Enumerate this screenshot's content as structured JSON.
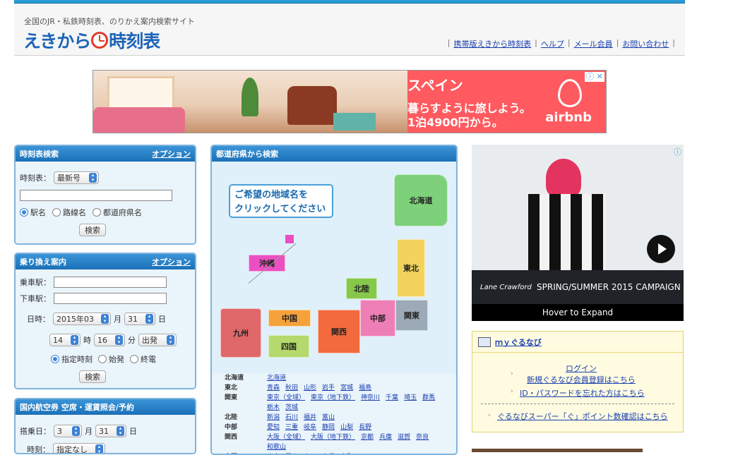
{
  "header": {
    "tagline": "全国のJR・私鉄時刻表、のりかえ案内検索サイト",
    "logo_left": "えきから",
    "logo_right": "時刻表",
    "links": [
      "携帯版えきから時刻表",
      "ヘルプ",
      "メール会員",
      "お問い合わせ"
    ]
  },
  "ad_banner": {
    "title": "スペイン",
    "line1": "暮らすように旅しよう。",
    "line2": "1泊4900円から。",
    "brand": "airbnb",
    "close": "ⓘ ✕"
  },
  "timetable": {
    "title": "時刻表検索",
    "option": "オプション",
    "label": "時刻表：",
    "select": "最新号",
    "radios": [
      "駅名",
      "路線名",
      "都道府県名"
    ],
    "search": "検索"
  },
  "transfer": {
    "title": "乗り換え案内",
    "option": "オプション",
    "from_label": "乗車駅：",
    "to_label": "下車駅：",
    "date_label": "日時：",
    "year": "2015年03",
    "month_unit": "月",
    "day": "31",
    "day_unit": "日",
    "hour": "14",
    "hour_unit": "時",
    "minute": "16",
    "minute_unit": "分",
    "mode": "出発",
    "radios": [
      "指定時刻",
      "始発",
      "終電"
    ],
    "search": "検索"
  },
  "flight": {
    "title": "国内航空券 空席・運賃照会/予約",
    "date_label": "搭乗日：",
    "month": "3",
    "month_unit": "月",
    "day": "31",
    "day_unit": "日",
    "time_label": "時刻：",
    "time": "指定なし"
  },
  "map_panel": {
    "title": "都道府県から検索",
    "hint_line1": "ご希望の地域名を",
    "hint_line2": "クリックしてください",
    "regions": {
      "hokkaido": "北海道",
      "tohoku": "東北",
      "hokuriku": "北陸",
      "kanto": "関東",
      "chubu": "中部",
      "kansai": "関西",
      "chugoku": "中国",
      "shikoku": "四国",
      "kyushu": "九州",
      "okinawa": "沖縄"
    },
    "region_list": [
      {
        "name": "北海道",
        "prefs": [
          "北海道"
        ]
      },
      {
        "name": "東北",
        "prefs": [
          "青森",
          "秋田",
          "山形",
          "岩手",
          "宮城",
          "福島"
        ]
      },
      {
        "name": "関東",
        "prefs": [
          "東京（全域）",
          "東京（地下鉄）",
          "神奈川",
          "千葉",
          "埼玉",
          "群馬",
          "栃木",
          "茨城"
        ]
      },
      {
        "name": "北陸",
        "prefs": [
          "新潟",
          "石川",
          "福井",
          "富山"
        ]
      },
      {
        "name": "中部",
        "prefs": [
          "愛知",
          "三重",
          "岐阜",
          "静岡",
          "山梨",
          "長野"
        ]
      },
      {
        "name": "関西",
        "prefs": [
          "大阪（全域）",
          "大阪（地下鉄）",
          "京都",
          "兵庫",
          "滋賀",
          "奈良",
          "和歌山"
        ]
      },
      {
        "name": "中国",
        "prefs": [
          "広島",
          "岡山",
          "山口",
          "島根",
          "鳥取"
        ]
      }
    ]
  },
  "ad_right": {
    "brand": "Lane Crawford",
    "campaign": "SPRING/SUMMER 2015 CAMPAIGN",
    "hover": "Hover to Expand",
    "info": "ⓘ"
  },
  "mygurunavi": {
    "title": "ｍｙぐるなび",
    "login": "ログイン",
    "register": "新規ぐるなび会員登録はこちら",
    "forgot": "ID・パスワードを忘れた方はこちら",
    "points": "ぐるなびスーパー「ぐ」ポイント数確認はこちら"
  }
}
